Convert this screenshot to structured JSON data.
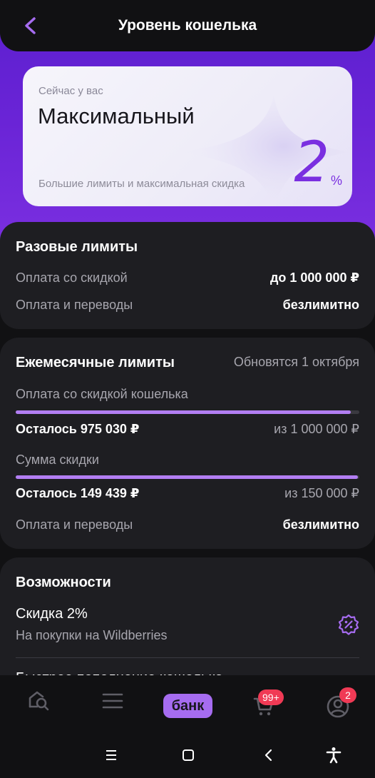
{
  "header": {
    "title": "Уровень кошелька"
  },
  "level_card": {
    "subtitle": "Сейчас у вас",
    "level": "Максимальный",
    "description": "Большие лимиты и максимальная скидка",
    "percent": "2",
    "percent_sign": "%"
  },
  "one_time_limits": {
    "title": "Разовые лимиты",
    "rows": [
      {
        "label": "Оплата со скидкой",
        "value": "до 1 000 000 ₽"
      },
      {
        "label": "Оплата и переводы",
        "value": "безлимитно"
      }
    ]
  },
  "monthly_limits": {
    "title": "Ежемесячные лимиты",
    "update_note": "Обновятся 1 октября",
    "items": [
      {
        "label": "Оплата со скидкой кошелька",
        "remaining": "Осталось 975 030 ₽",
        "total": "из 1 000 000 ₽",
        "progress": 0.975
      },
      {
        "label": "Сумма скидки",
        "remaining": "Осталось 149 439 ₽",
        "total": "из 150 000 ₽",
        "progress": 0.996
      }
    ],
    "transfers": {
      "label": "Оплата и переводы",
      "value": "безлимитно"
    }
  },
  "features": {
    "title": "Возможности",
    "items": [
      {
        "title": "Скидка 2%",
        "subtitle": "На покупки на Wildberries",
        "icon": "discount-badge-icon"
      },
      {
        "title": "Быстрое пополнение кошелька"
      }
    ]
  },
  "bottom_nav": {
    "bank_label": "банк",
    "cart_badge": "99+",
    "profile_badge": "2"
  },
  "colors": {
    "accent": "#7a2fe0",
    "progress": "#b27ef2",
    "badge": "#f03a55"
  }
}
